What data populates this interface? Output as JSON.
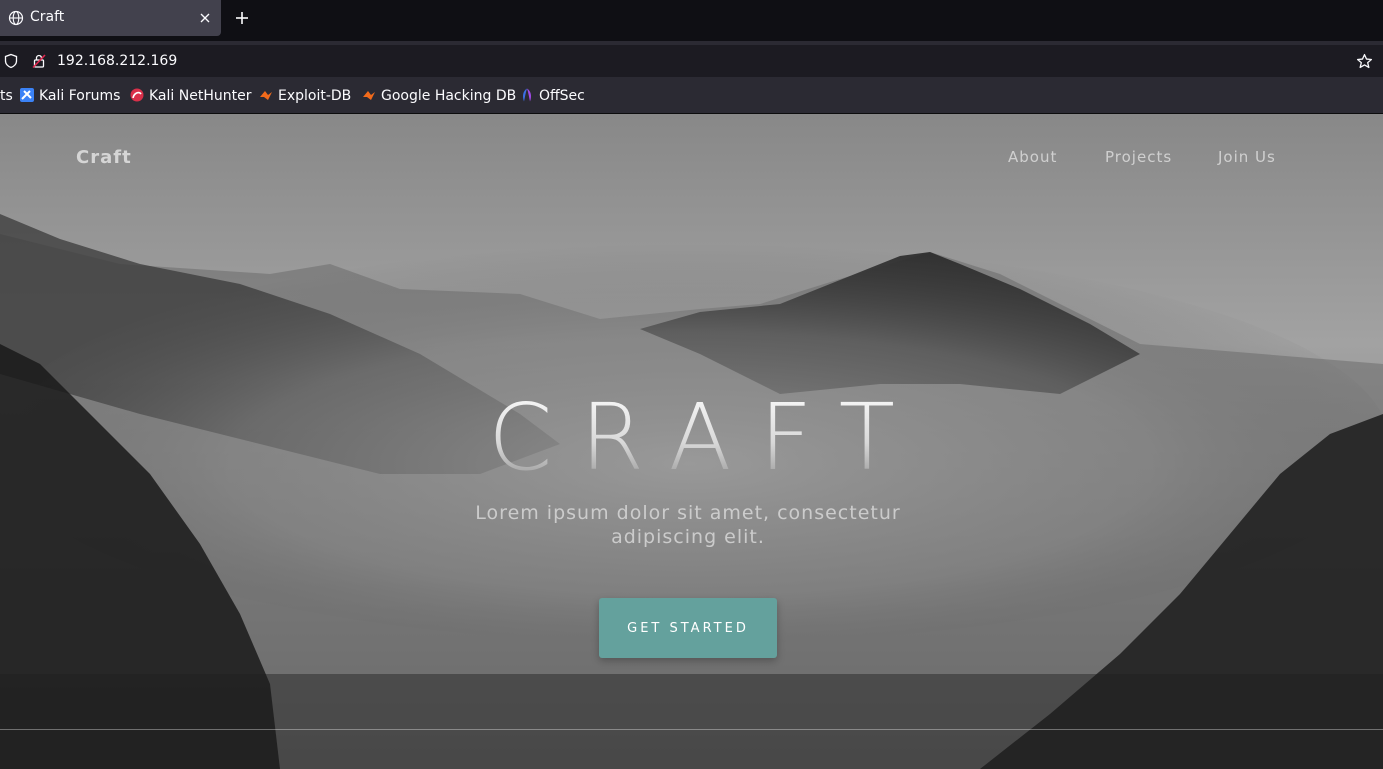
{
  "browser": {
    "tab_title": "Craft",
    "url": "192.168.212.169",
    "bookmarks": [
      {
        "label": "ts",
        "icon": "bookmark-truncated"
      },
      {
        "label": "Kali Forums",
        "icon": "kali-forums-icon"
      },
      {
        "label": "Kali NetHunter",
        "icon": "kali-nethunter-icon"
      },
      {
        "label": "Exploit-DB",
        "icon": "exploit-db-icon"
      },
      {
        "label": "Google Hacking DB",
        "icon": "ghdb-icon"
      },
      {
        "label": "OffSec",
        "icon": "offsec-icon"
      }
    ]
  },
  "site": {
    "brand": "Craft",
    "nav": [
      "About",
      "Projects",
      "Join Us"
    ],
    "hero": {
      "title": "CRAFT",
      "subtitle": "Lorem ipsum dolor sit amet, consectetur adipiscing elit.",
      "cta": "GET STARTED"
    }
  },
  "colors": {
    "cta": "#64a19d",
    "browser_tab": "#42414d",
    "browser_toolbar": "#2b2a33"
  }
}
